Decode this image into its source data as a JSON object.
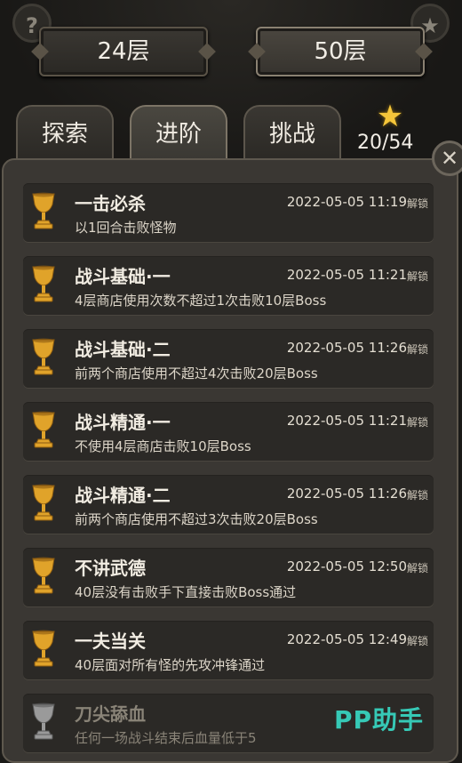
{
  "header": {
    "left_icon": "?",
    "right_icon": "★",
    "floor_current": "24层",
    "floor_max": "50层"
  },
  "tabs": [
    {
      "label": "探索"
    },
    {
      "label": "进阶"
    },
    {
      "label": "挑战"
    }
  ],
  "progress": {
    "icon": "star-icon",
    "text": "20/54"
  },
  "close_label": "✕",
  "achievements": [
    {
      "title": "一击必杀",
      "desc": "以1回合击败怪物",
      "time": "2022-05-05 11:19",
      "status": "解锁",
      "trophy": "gold"
    },
    {
      "title": "战斗基础·一",
      "desc": "4层商店使用次数不超过1次击败10层Boss",
      "time": "2022-05-05 11:21",
      "status": "解锁",
      "trophy": "gold"
    },
    {
      "title": "战斗基础·二",
      "desc": "前两个商店使用不超过4次击败20层Boss",
      "time": "2022-05-05 11:26",
      "status": "解锁",
      "trophy": "gold"
    },
    {
      "title": "战斗精通·一",
      "desc": "不使用4层商店击败10层Boss",
      "time": "2022-05-05 11:21",
      "status": "解锁",
      "trophy": "gold"
    },
    {
      "title": "战斗精通·二",
      "desc": "前两个商店使用不超过3次击败20层Boss",
      "time": "2022-05-05 11:26",
      "status": "解锁",
      "trophy": "gold"
    },
    {
      "title": "不讲武德",
      "desc": "40层没有击败手下直接击败Boss通过",
      "time": "2022-05-05 12:50",
      "status": "解锁",
      "trophy": "gold"
    },
    {
      "title": "一夫当关",
      "desc": "40层面对所有怪的先攻冲锋通过",
      "time": "2022-05-05 12:49",
      "status": "解锁",
      "trophy": "gold"
    },
    {
      "title": "刀尖舔血",
      "desc": "任何一场战斗结束后血量低于5",
      "time": "",
      "status": "",
      "trophy": "silver"
    }
  ],
  "watermark": "PP助手",
  "colors": {
    "gold_trophy": "#e0a32a",
    "silver_trophy": "#9a9a9a",
    "star": "#f5c63a",
    "watermark": "#36c9b6"
  }
}
